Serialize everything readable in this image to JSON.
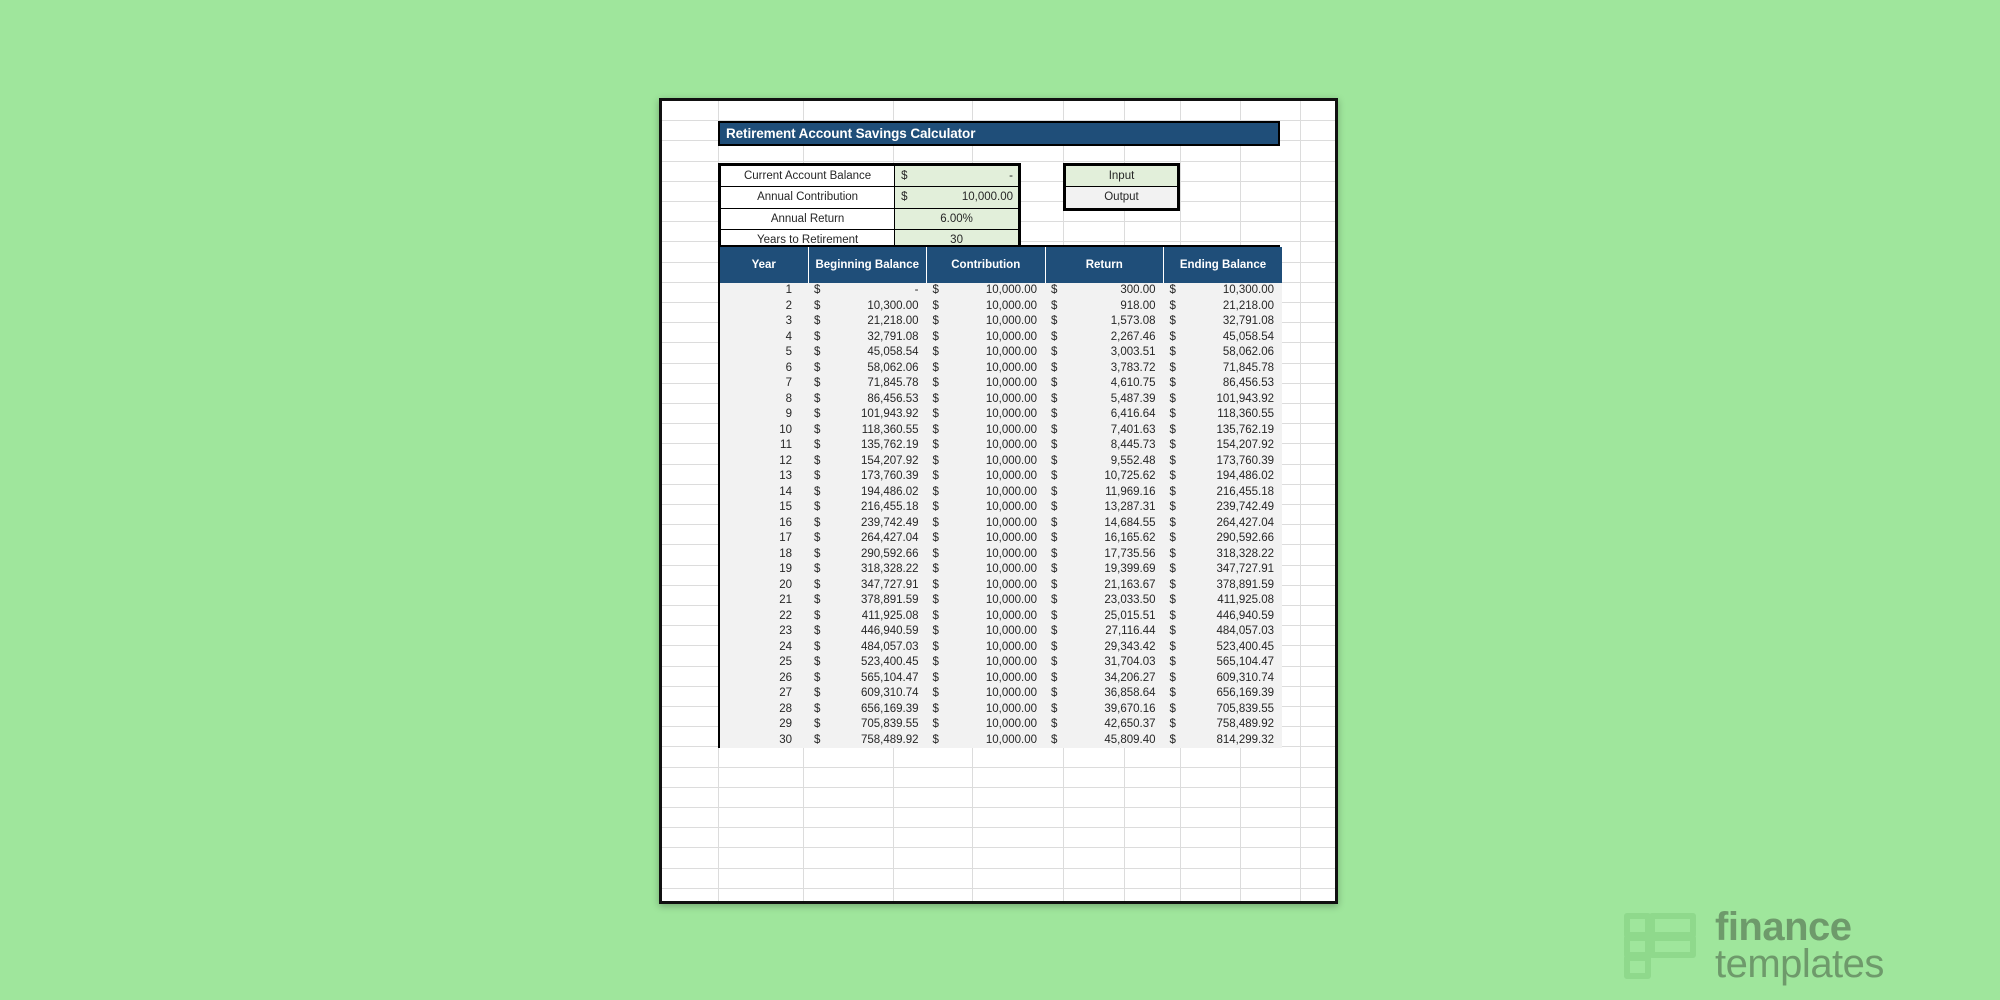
{
  "background_color": "#9FE69C",
  "accent_color": "#1F4E79",
  "input_color": "#E2EFDA",
  "output_color": "#F2F2F2",
  "sheet": {
    "title": "Retirement Account Savings Calculator"
  },
  "inputs": {
    "rows": [
      {
        "label": "Current Account Balance",
        "currency": "$",
        "value": "-",
        "kind": "money"
      },
      {
        "label": "Annual Contribution",
        "currency": "$",
        "value": "10,000.00",
        "kind": "money"
      },
      {
        "label": "Annual Return",
        "currency": "",
        "value": "6.00%",
        "kind": "plain"
      },
      {
        "label": "Years to Retirement",
        "currency": "",
        "value": "30",
        "kind": "plain"
      }
    ]
  },
  "legend": {
    "input_label": "Input",
    "output_label": "Output"
  },
  "chart_data": {
    "type": "table",
    "title": "Retirement Account Savings Calculator",
    "columns": [
      "Year",
      "Beginning Balance",
      "Contribution",
      "Return",
      "Ending Balance"
    ],
    "currency_symbol": "$",
    "assumptions": {
      "current_account_balance": 0,
      "annual_contribution": 10000,
      "annual_return_pct": 6.0,
      "years_to_retirement": 30
    },
    "rows": [
      {
        "year": "1",
        "beginning": "-",
        "contribution": "10,000.00",
        "return": "300.00",
        "ending": "10,300.00"
      },
      {
        "year": "2",
        "beginning": "10,300.00",
        "contribution": "10,000.00",
        "return": "918.00",
        "ending": "21,218.00"
      },
      {
        "year": "3",
        "beginning": "21,218.00",
        "contribution": "10,000.00",
        "return": "1,573.08",
        "ending": "32,791.08"
      },
      {
        "year": "4",
        "beginning": "32,791.08",
        "contribution": "10,000.00",
        "return": "2,267.46",
        "ending": "45,058.54"
      },
      {
        "year": "5",
        "beginning": "45,058.54",
        "contribution": "10,000.00",
        "return": "3,003.51",
        "ending": "58,062.06"
      },
      {
        "year": "6",
        "beginning": "58,062.06",
        "contribution": "10,000.00",
        "return": "3,783.72",
        "ending": "71,845.78"
      },
      {
        "year": "7",
        "beginning": "71,845.78",
        "contribution": "10,000.00",
        "return": "4,610.75",
        "ending": "86,456.53"
      },
      {
        "year": "8",
        "beginning": "86,456.53",
        "contribution": "10,000.00",
        "return": "5,487.39",
        "ending": "101,943.92"
      },
      {
        "year": "9",
        "beginning": "101,943.92",
        "contribution": "10,000.00",
        "return": "6,416.64",
        "ending": "118,360.55"
      },
      {
        "year": "10",
        "beginning": "118,360.55",
        "contribution": "10,000.00",
        "return": "7,401.63",
        "ending": "135,762.19"
      },
      {
        "year": "11",
        "beginning": "135,762.19",
        "contribution": "10,000.00",
        "return": "8,445.73",
        "ending": "154,207.92"
      },
      {
        "year": "12",
        "beginning": "154,207.92",
        "contribution": "10,000.00",
        "return": "9,552.48",
        "ending": "173,760.39"
      },
      {
        "year": "13",
        "beginning": "173,760.39",
        "contribution": "10,000.00",
        "return": "10,725.62",
        "ending": "194,486.02"
      },
      {
        "year": "14",
        "beginning": "194,486.02",
        "contribution": "10,000.00",
        "return": "11,969.16",
        "ending": "216,455.18"
      },
      {
        "year": "15",
        "beginning": "216,455.18",
        "contribution": "10,000.00",
        "return": "13,287.31",
        "ending": "239,742.49"
      },
      {
        "year": "16",
        "beginning": "239,742.49",
        "contribution": "10,000.00",
        "return": "14,684.55",
        "ending": "264,427.04"
      },
      {
        "year": "17",
        "beginning": "264,427.04",
        "contribution": "10,000.00",
        "return": "16,165.62",
        "ending": "290,592.66"
      },
      {
        "year": "18",
        "beginning": "290,592.66",
        "contribution": "10,000.00",
        "return": "17,735.56",
        "ending": "318,328.22"
      },
      {
        "year": "19",
        "beginning": "318,328.22",
        "contribution": "10,000.00",
        "return": "19,399.69",
        "ending": "347,727.91"
      },
      {
        "year": "20",
        "beginning": "347,727.91",
        "contribution": "10,000.00",
        "return": "21,163.67",
        "ending": "378,891.59"
      },
      {
        "year": "21",
        "beginning": "378,891.59",
        "contribution": "10,000.00",
        "return": "23,033.50",
        "ending": "411,925.08"
      },
      {
        "year": "22",
        "beginning": "411,925.08",
        "contribution": "10,000.00",
        "return": "25,015.51",
        "ending": "446,940.59"
      },
      {
        "year": "23",
        "beginning": "446,940.59",
        "contribution": "10,000.00",
        "return": "27,116.44",
        "ending": "484,057.03"
      },
      {
        "year": "24",
        "beginning": "484,057.03",
        "contribution": "10,000.00",
        "return": "29,343.42",
        "ending": "523,400.45"
      },
      {
        "year": "25",
        "beginning": "523,400.45",
        "contribution": "10,000.00",
        "return": "31,704.03",
        "ending": "565,104.47"
      },
      {
        "year": "26",
        "beginning": "565,104.47",
        "contribution": "10,000.00",
        "return": "34,206.27",
        "ending": "609,310.74"
      },
      {
        "year": "27",
        "beginning": "609,310.74",
        "contribution": "10,000.00",
        "return": "36,858.64",
        "ending": "656,169.39"
      },
      {
        "year": "28",
        "beginning": "656,169.39",
        "contribution": "10,000.00",
        "return": "39,670.16",
        "ending": "705,839.55"
      },
      {
        "year": "29",
        "beginning": "705,839.55",
        "contribution": "10,000.00",
        "return": "42,650.37",
        "ending": "758,489.92"
      },
      {
        "year": "30",
        "beginning": "758,489.92",
        "contribution": "10,000.00",
        "return": "45,809.40",
        "ending": "814,299.32"
      }
    ]
  },
  "watermark": {
    "line1": "finance",
    "line2": "templates"
  }
}
